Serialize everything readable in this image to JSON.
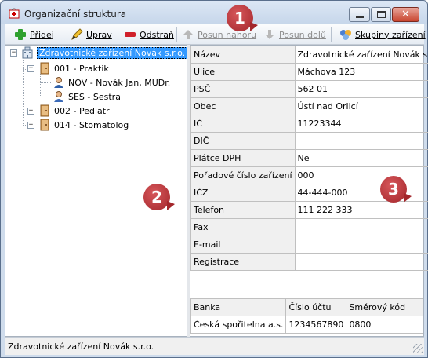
{
  "window": {
    "title": "Organizační struktura"
  },
  "toolbar": {
    "add": "Přidej",
    "edit": "Uprav",
    "remove": "Odstraň",
    "move_up": "Posun nahoru",
    "move_down": "Posun dolů",
    "groups": "Skupiny zařízení"
  },
  "tree": {
    "root": "Zdravotnické zařízení Novák s.r.o.",
    "n1": "001 - Praktik",
    "n1a": "NOV - Novák Jan, MUDr.",
    "n1b": "SES - Sestra",
    "n2": "002 - Pediatr",
    "n3": "014 - Stomatolog"
  },
  "properties": [
    {
      "key": "Název",
      "value": "Zdravotnické zařízení Novák s.r.o."
    },
    {
      "key": "Ulice",
      "value": "Máchova 123"
    },
    {
      "key": "PSČ",
      "value": "562 01"
    },
    {
      "key": "Obec",
      "value": "Ústí nad Orlicí"
    },
    {
      "key": "IČ",
      "value": "11223344"
    },
    {
      "key": "DIČ",
      "value": ""
    },
    {
      "key": "Plátce DPH",
      "value": "Ne"
    },
    {
      "key": "Pořadové číslo zařízení",
      "value": "000"
    },
    {
      "key": "IČZ",
      "value": "44-444-000"
    },
    {
      "key": "Telefon",
      "value": "111 222 333"
    },
    {
      "key": "Fax",
      "value": ""
    },
    {
      "key": "E-mail",
      "value": ""
    },
    {
      "key": "Registrace",
      "value": ""
    }
  ],
  "bank": {
    "headers": [
      "Banka",
      "Číslo účtu",
      "Směrový kód"
    ],
    "row": [
      "Česká spořitelna a.s.",
      "1234567890",
      "0800"
    ]
  },
  "status": "Zdravotnické zařízení Novák s.r.o.",
  "callouts": [
    "1",
    "2",
    "3"
  ]
}
